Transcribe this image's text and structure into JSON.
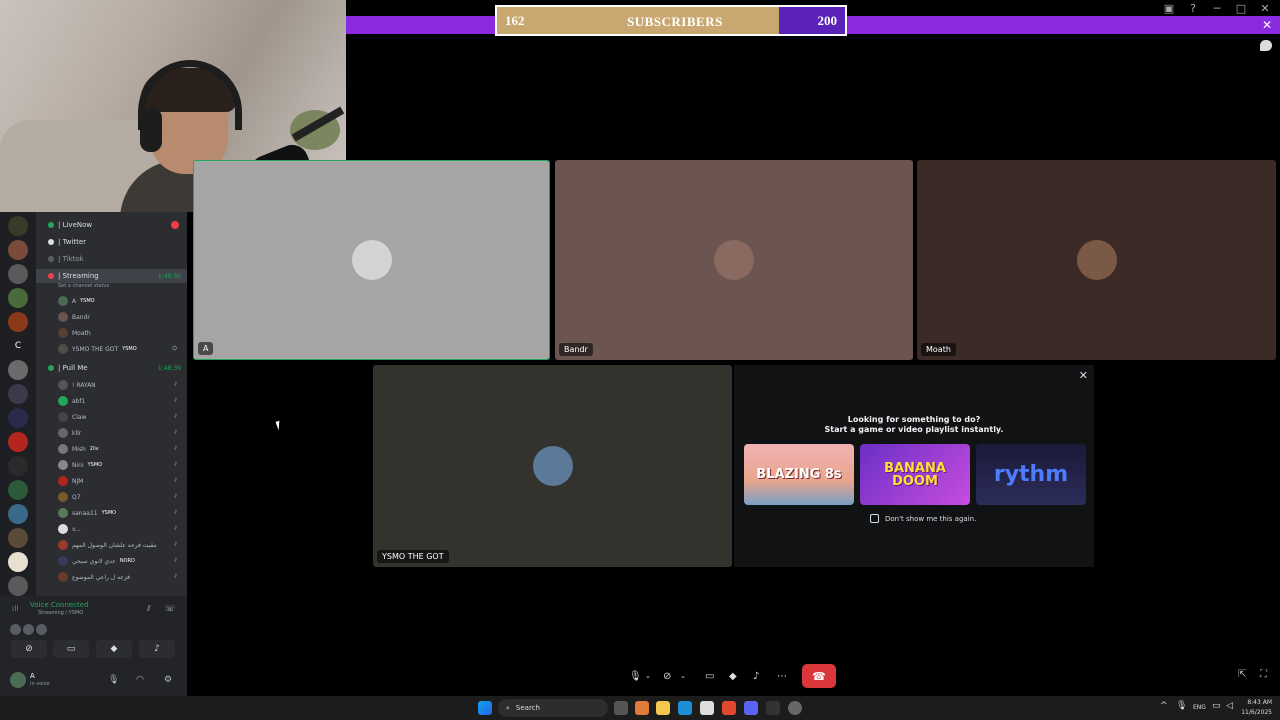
{
  "subscriber_goal": {
    "current": "162",
    "label": "SUBSCRIBERS",
    "target": "200",
    "progress": 0.81
  },
  "window_controls": [
    "tv-icon",
    "help-icon",
    "minimize-icon",
    "maximize-icon",
    "close-icon"
  ],
  "colors": {
    "accent": "#8a2be2",
    "goal_fill": "#c8a870",
    "online": "#23a55a",
    "danger": "#da373c",
    "live": "#f23f43"
  },
  "servers": [
    {
      "icon": "server-logo-icon"
    },
    {
      "icon": "server-avatar-icon"
    },
    {
      "icon": "server-art-icon"
    },
    {
      "icon": "server-game-icon"
    },
    {
      "icon": "server-flame-icon"
    },
    {
      "label": "C"
    },
    {
      "icon": "server-photo-icon"
    },
    {
      "icon": "server-mt-icon"
    },
    {
      "icon": "server-play-icon"
    },
    {
      "icon": "server-red-icon"
    },
    {
      "icon": "server-d-icon"
    },
    {
      "icon": "server-green-icon"
    },
    {
      "icon": "server-multi-icon"
    },
    {
      "icon": "server-cat-icon"
    },
    {
      "icon": "server-pixel-icon"
    },
    {
      "icon": "server-add-icon"
    }
  ],
  "channels": {
    "items": [
      {
        "label": "| LiveNow",
        "status_color": "#23a55a",
        "has_badge": true
      },
      {
        "label": "| Twitter",
        "status_color": "#dbdee1"
      },
      {
        "label": "| Tiktok",
        "status_color": "#949ba4"
      },
      {
        "label": "| Streaming",
        "status_color": "#f23f43",
        "time": "1:49:50",
        "status": "Set a channel status"
      }
    ],
    "streaming_members": [
      {
        "name": "A",
        "tag": "YSMO"
      },
      {
        "name": "Bandr"
      },
      {
        "name": "Moath"
      },
      {
        "name": "YSMO THE GOT",
        "tag": "YSMO"
      }
    ],
    "pull_me": {
      "label": "| Pull Me",
      "time": "1:48:39"
    },
    "pull_members": [
      {
        "name": "! RAYAN"
      },
      {
        "name": "abf1"
      },
      {
        "name": "Claw"
      },
      {
        "name": "kllr"
      },
      {
        "name": "Mish",
        "tag": "2liv"
      },
      {
        "name": "Nini",
        "tag": "YSMO"
      },
      {
        "name": "NJM"
      },
      {
        "name": "Q7"
      },
      {
        "name": "sanaa11",
        "tag": "YSMO"
      },
      {
        "name": "v..."
      },
      {
        "name": "مقيت فرحه علشان الوصول المهم"
      },
      {
        "name": "عدي لانوي سيحي",
        "tag": "NORD"
      },
      {
        "name": "فزعه ل راعي الموضوع"
      }
    ]
  },
  "voice_panel": {
    "title": "Voice Connected",
    "subtitle": "Streaming / YSMO",
    "user": {
      "name": "A",
      "status": "In voice"
    }
  },
  "tiles": {
    "a": {
      "name": "A"
    },
    "bandr": {
      "name": "Bandr"
    },
    "moath": {
      "name": "Moath"
    },
    "ysmo": {
      "name": "YSMO THE GOT"
    }
  },
  "activity": {
    "title": "Looking for something to do?",
    "subtitle": "Start a game or video playlist instantly.",
    "cards": [
      {
        "label": "BLAZING 8s"
      },
      {
        "label": "BANANA DOOM"
      },
      {
        "label": "rythm"
      }
    ],
    "dont_show": "Don't show me this again."
  },
  "taskbar": {
    "search_placeholder": "Search",
    "lang": "ENG",
    "time": "8:43 AM",
    "date": "11/6/2025"
  }
}
